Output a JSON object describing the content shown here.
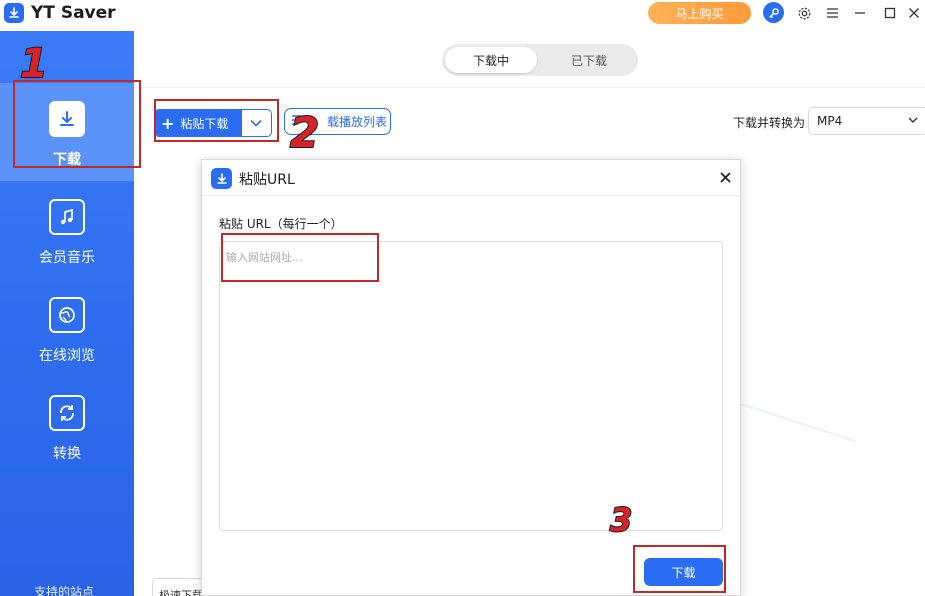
{
  "app": {
    "title": "YT Saver",
    "buy_label": "马上购买",
    "controls": [
      "key-icon",
      "gear-icon",
      "menu-icon",
      "minimize-icon",
      "maximize-icon",
      "close-icon"
    ]
  },
  "sidebar": {
    "items": [
      {
        "label": "下载",
        "icon": "download-icon",
        "active": true
      },
      {
        "label": "会员音乐",
        "icon": "music-icon",
        "active": false
      },
      {
        "label": "在线浏览",
        "icon": "globe-icon",
        "active": false
      },
      {
        "label": "转换",
        "icon": "convert-icon",
        "active": false
      }
    ],
    "footer": "支持的站点"
  },
  "main": {
    "tabs": [
      {
        "label": "下载中",
        "active": true
      },
      {
        "label": "已下载",
        "active": false
      }
    ],
    "paste_label": "粘贴下载",
    "playlist_label": "载播放列表",
    "convert_label": "下载并转换为",
    "format_value": "MP4",
    "bottom_label": "极速下载"
  },
  "modal": {
    "title": "粘贴URL",
    "url_label": "粘贴 URL（每行一个）",
    "url_placeholder": "输入网站网址...",
    "url_value": "",
    "download_label": "下载"
  },
  "annotations": {
    "steps": [
      "1",
      "2",
      "3"
    ]
  },
  "colors": {
    "accent": "#2a6df4",
    "sidebar": "#3b7bf6",
    "buy": "#ff9a3a",
    "marker": "#c0282a"
  }
}
